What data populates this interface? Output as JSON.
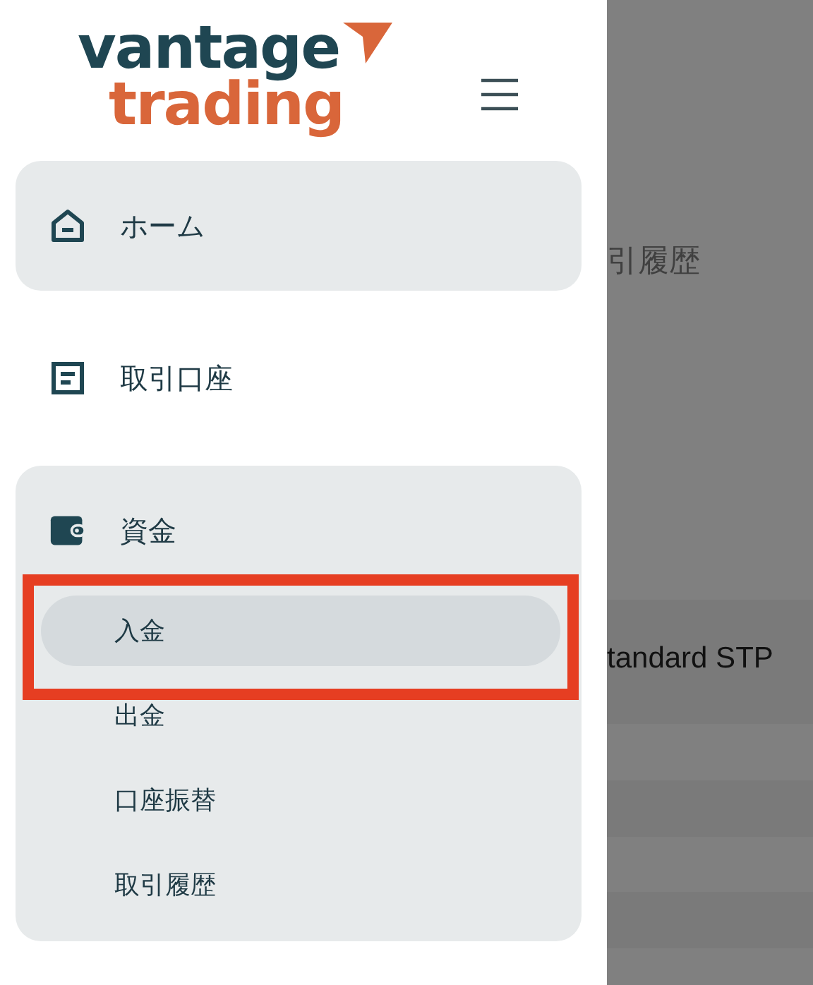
{
  "logo": {
    "line_1": "vantage",
    "line_2": "trading"
  },
  "menu": [
    {
      "label": "ホーム",
      "kind": "home",
      "selected": true
    },
    {
      "label": "取引口座",
      "kind": "document",
      "selected": false
    },
    {
      "label": "資金",
      "kind": "wallet",
      "selected": false,
      "expanded": true,
      "children": [
        {
          "label": "入金",
          "selected": true,
          "highlighted": true
        },
        {
          "label": "出金",
          "selected": false,
          "highlighted": false
        },
        {
          "label": "口座振替",
          "selected": false,
          "highlighted": false
        },
        {
          "label": "取引履歴",
          "selected": false,
          "highlighted": false
        }
      ]
    }
  ],
  "background_page": {
    "heading": "引履歴",
    "row_text": "tandard STP"
  }
}
